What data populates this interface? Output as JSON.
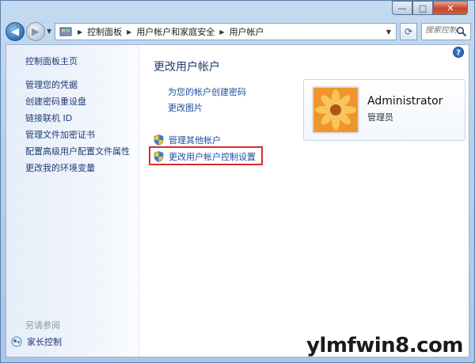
{
  "window": {
    "caption": {
      "minimize": "—",
      "maximize": "□",
      "close": "✕"
    }
  },
  "navbar": {
    "back": "◀",
    "forward": "▶",
    "recent": "▼",
    "breadcrumb": [
      "控制面板",
      "用户帐户和家庭安全",
      "用户帐户"
    ],
    "address_dropdown": "▼",
    "refresh": "⟳",
    "search_placeholder": "搜索控制面板"
  },
  "sidebar": {
    "home": "控制面板主页",
    "links": [
      "管理您的凭据",
      "创建密码重设盘",
      "链接联机 ID",
      "管理文件加密证书",
      "配置高级用户配置文件属性",
      "更改我的环境变量"
    ],
    "see_also": "另请参阅",
    "parental_control": "家长控制"
  },
  "main": {
    "title": "更改用户帐户",
    "tasks": [
      "为您的帐户创建密码",
      "更改图片"
    ],
    "shield_tasks": [
      "管理其他帐户",
      "更改用户帐户控制设置"
    ]
  },
  "user": {
    "name": "Administrator",
    "role": "管理员"
  },
  "watermark": "ylmfwin8.com",
  "colors": {
    "link": "#1e4fa3",
    "highlight": "#d82c2c",
    "close": "#c8452b"
  }
}
